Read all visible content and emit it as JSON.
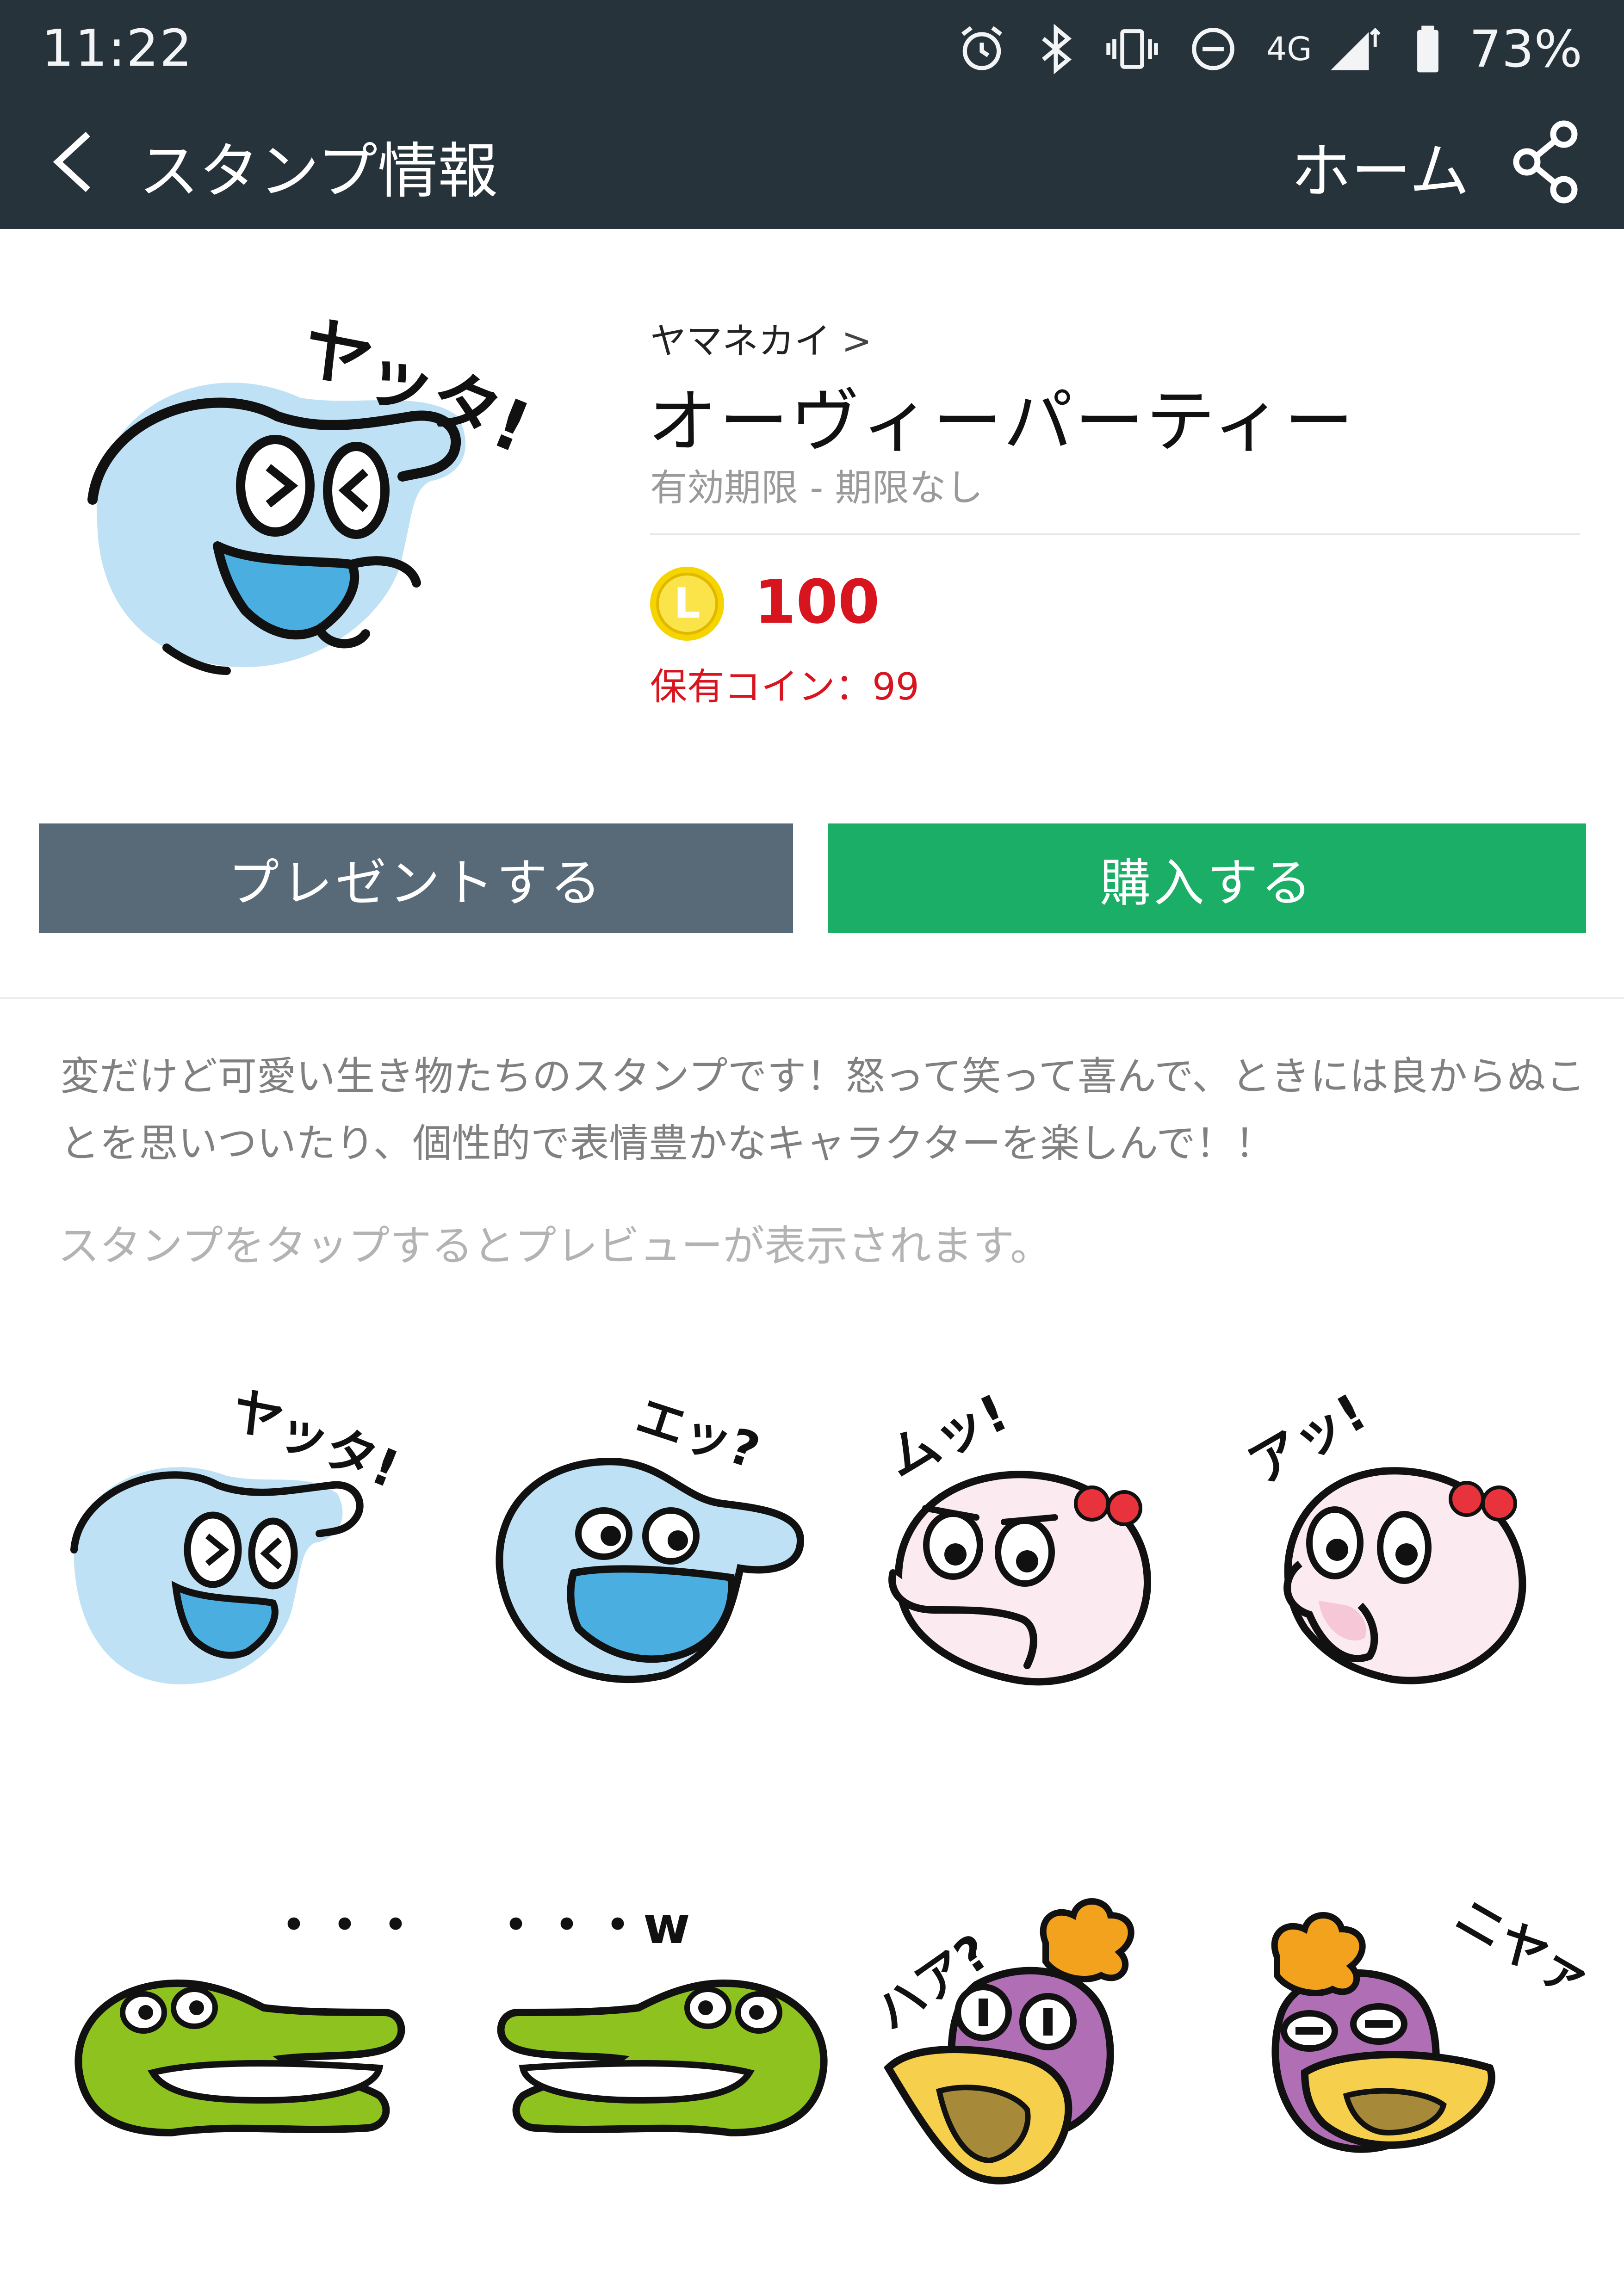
{
  "status_bar": {
    "time": "11:22",
    "network": "4G",
    "battery": "73%",
    "icons": [
      "alarm-icon",
      "bluetooth-icon",
      "vibrate-icon",
      "do-not-disturb-icon",
      "signal-icon",
      "battery-icon"
    ]
  },
  "app_bar": {
    "title": "スタンプ情報",
    "home_label": "ホーム",
    "back_icon": "chevron-left-icon",
    "share_icon": "share-icon",
    "background": "#27333b"
  },
  "package": {
    "author": "ヤマネカイ",
    "author_chevron": ">",
    "title": "オーヴィーパーティー",
    "validity": "有効期限 - 期限なし",
    "coin_letter": "L",
    "price": "100",
    "owned_coins": "保有コイン：99",
    "price_color": "#d8141f"
  },
  "buttons": {
    "present": "プレゼントする",
    "buy": "購入する",
    "present_color": "#586977",
    "buy_color": "#1bae67"
  },
  "description": "変だけど可愛い生き物たちのスタンプです！怒って笑って喜んで、ときには良からぬことを思いついたり、個性的で表情豊かなキャラクターを楽しんで！！",
  "preview_hint": "スタンプをタップするとプレビューが表示されます。",
  "stickers": [
    {
      "caption": "ヤッタ!"
    },
    {
      "caption": "エッ?"
    },
    {
      "caption": "ムッ!"
    },
    {
      "caption": "アッ!"
    },
    {
      "caption": "・・・"
    },
    {
      "caption": "・・・w"
    },
    {
      "caption": "ハア?"
    },
    {
      "caption": "ニヤァ"
    }
  ]
}
